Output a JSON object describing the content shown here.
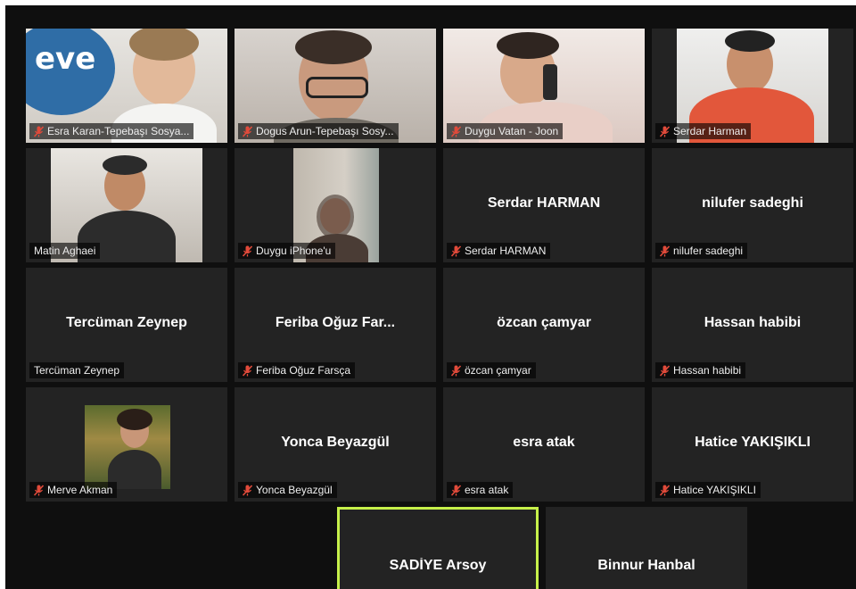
{
  "participants": [
    {
      "name": "Esra Karan-Tepebaşı Sosya...",
      "muted": true
    },
    {
      "name": "Dogus Arun-Tepebaşı Sosy...",
      "muted": true
    },
    {
      "name": "Duygu Vatan - Joon",
      "muted": true
    },
    {
      "name": "Serdar Harman",
      "muted": true
    },
    {
      "name": "Matin Aghaei",
      "muted": false
    },
    {
      "name": "Duygu iPhone'u",
      "muted": true
    },
    {
      "display": "Serdar HARMAN",
      "name": "Serdar HARMAN",
      "muted": true
    },
    {
      "display": "nilufer sadeghi",
      "name": "nilufer sadeghi",
      "muted": true
    },
    {
      "display": "Tercüman Zeynep",
      "name": "Tercüman Zeynep",
      "muted": false
    },
    {
      "display": "Feriba Oğuz Far...",
      "name": "Feriba Oğuz Farsça",
      "muted": true
    },
    {
      "display": "özcan çamyar",
      "name": "özcan çamyar",
      "muted": true
    },
    {
      "display": "Hassan habibi",
      "name": "Hassan habibi",
      "muted": true
    },
    {
      "name": "Merve Akman",
      "muted": true
    },
    {
      "display": "Yonca Beyazgül",
      "name": "Yonca Beyazgül",
      "muted": true
    },
    {
      "display": "esra atak",
      "name": "esra atak",
      "muted": true
    },
    {
      "display": "Hatice YAKIŞIKLI",
      "name": "Hatice YAKIŞIKLI",
      "muted": true
    },
    {
      "display": "SADİYE Arsoy",
      "active_speaker": true
    },
    {
      "display": "Binnur Hanbal"
    }
  ],
  "logo_text": "eve",
  "colors": {
    "tile_bg": "#232323",
    "active_speaker_border": "#c6f04a",
    "muted_icon": "#e04a3a",
    "logo_blue": "#2f6da6"
  }
}
